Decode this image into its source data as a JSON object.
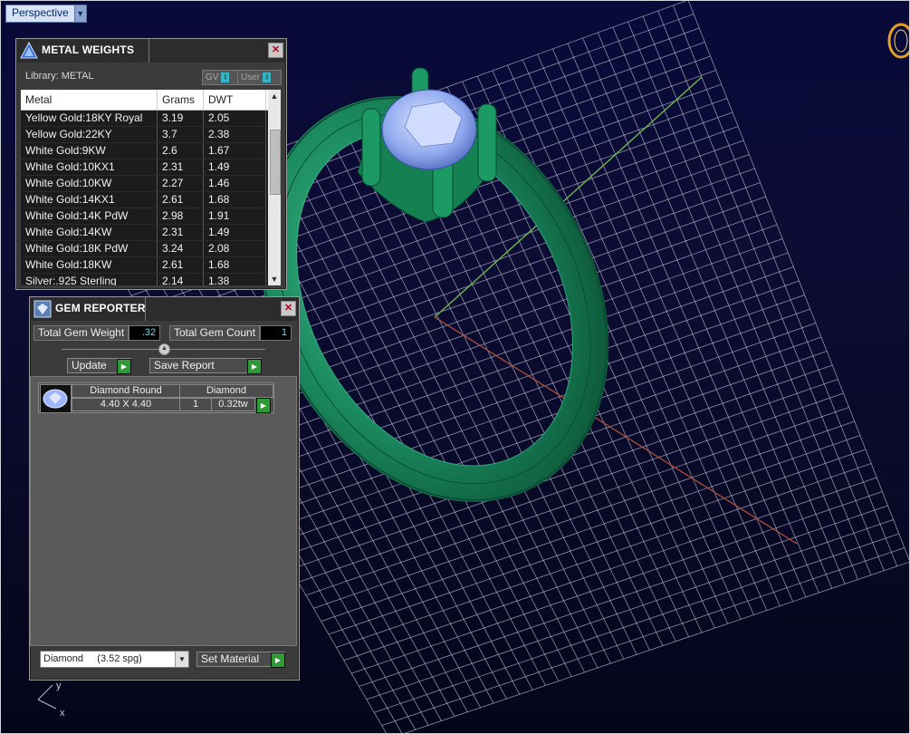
{
  "viewport": {
    "view_label": "Perspective",
    "axis_x": "x",
    "axis_y": "y"
  },
  "metal_weights": {
    "title": "METAL WEIGHTS",
    "library_label": "Library: METAL",
    "toggle_gv": "GV",
    "toggle_user": "User",
    "columns": [
      "Metal",
      "Grams",
      "DWT"
    ],
    "rows": [
      [
        "Yellow Gold:18KY Royal",
        "3.19",
        "2.05"
      ],
      [
        "Yellow Gold:22KY",
        "3.7",
        "2.38"
      ],
      [
        "White Gold:9KW",
        "2.6",
        "1.67"
      ],
      [
        "White Gold:10KX1",
        "2.31",
        "1.49"
      ],
      [
        "White Gold:10KW",
        "2.27",
        "1.46"
      ],
      [
        "White Gold:14KX1",
        "2.61",
        "1.68"
      ],
      [
        "White Gold:14K PdW",
        "2.98",
        "1.91"
      ],
      [
        "White Gold:14KW",
        "2.31",
        "1.49"
      ],
      [
        "White Gold:18K PdW",
        "3.24",
        "2.08"
      ],
      [
        "White Gold:18KW",
        "2.61",
        "1.68"
      ],
      [
        "Silver:.925 Sterling",
        "2.14",
        "1.38"
      ]
    ]
  },
  "gem_reporter": {
    "title": "GEM REPORTER",
    "total_weight_label": "Total Gem Weight",
    "total_weight_value": ".32",
    "total_count_label": "Total Gem Count",
    "total_count_value": "1",
    "update_label": "Update",
    "save_report_label": "Save Report",
    "gem": {
      "shape": "Diamond Round",
      "size": "4.40 X 4.40",
      "material": "Diamond",
      "count": "1",
      "weight": "0.32tw"
    },
    "material_select": "Diamond     (3.52 spg)",
    "set_material_label": "Set Material"
  },
  "colors": {
    "ring": "#1a8a5a",
    "gem": "#8fb0f0",
    "grid": "#c8c8d0",
    "accent_green": "#2e9a35"
  }
}
